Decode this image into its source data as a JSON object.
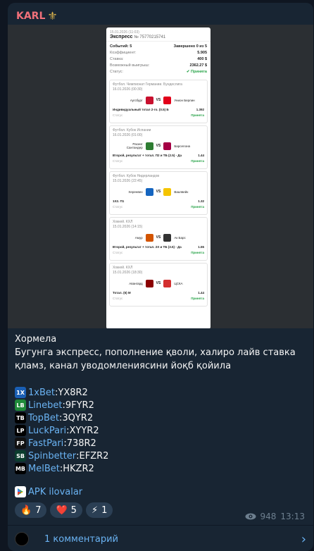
{
  "channel": {
    "name": "KARL",
    "emblem": "⚜"
  },
  "coupon": {
    "date": "15.01.2026 (11:03)",
    "type": "Экспресс",
    "number": "№ 75770215741",
    "events_label": "Событий: 5",
    "finished_label": "Завершено 0 из 5",
    "coef_label": "Коэффициент:",
    "coef_value": "5.905",
    "stake_label": "Ставка:",
    "stake_value": "400 $",
    "win_label": "Возможный выигрыш:",
    "win_value": "2362.27 $",
    "status_label": "Статус:",
    "status_value": "Принята",
    "matches": [
      {
        "league": "Футбол. Чемпионат Германии. Бундеслига",
        "date": "16.01.2026 (00:30)",
        "home": "Аугсбург",
        "away": "Унион Берлин",
        "vs": "VS",
        "bet": "Индивидуальный тотал 2-го. (0.5) Б",
        "odd": "1.392",
        "status_label": "Статус",
        "status": "Принята",
        "home_color": "#c8102e",
        "away_color": "#e2001a"
      },
      {
        "league": "Футбол. Кубок Испании",
        "date": "16.01.2026 (01:00)",
        "home": "Расинг Сантандер",
        "away": "Барселона",
        "vs": "VS",
        "bet": "Второй, результат + тотал. П2 и ТБ (2.5) - Да",
        "odd": "1.44",
        "status_label": "Статус",
        "status": "Принята",
        "home_color": "#2e7d32",
        "away_color": "#a50044"
      },
      {
        "league": "Футбол. Кубок Нидерландов",
        "date": "15.01.2026 (22:45)",
        "home": "Херенвен",
        "away": "Ваалвейк",
        "vs": "VS",
        "bet": "1Х2. П1",
        "odd": "1.32",
        "status_label": "Статус",
        "status": "Принята",
        "home_color": "#1565c0",
        "away_color": "#f5c400"
      },
      {
        "league": "Хоккей. КХЛ",
        "date": "15.01.2026 (14:15)",
        "home": "Амур",
        "away": "Ак Барс",
        "vs": "VS",
        "bet": "Второй, результат + тотал. 2Х и ТБ (3.5) - Да",
        "odd": "1.55",
        "status_label": "Статус",
        "status": "Принята",
        "home_color": "#d35400",
        "away_color": "#333333"
      },
      {
        "league": "Хоккей. КХЛ",
        "date": "15.01.2026 (18:30)",
        "home": "Авангард",
        "away": "ЦСКА",
        "vs": "VS",
        "bet": "Тотал. (6) М",
        "odd": "1.44",
        "status_label": "Статус",
        "status": "Принята",
        "home_color": "#8b0000",
        "away_color": "#d32f2f"
      }
    ]
  },
  "message": {
    "title": "Хормела",
    "body": "Бугунга экспресс, пополнение қволи, халиро лайв ставка қламз, канал уводомлениясини йоқб қойила"
  },
  "bookmakers": [
    {
      "name": "1xBet",
      "code": "YX8R2",
      "icon_text": "1X",
      "color": "#1a5fb4"
    },
    {
      "name": "Linebet",
      "code": "9FYR2",
      "icon_text": "LB",
      "color": "#1f8a3a"
    },
    {
      "name": "TopBet",
      "code": "3QYR2",
      "icon_text": "TB",
      "color": "#000000"
    },
    {
      "name": "LuckPari",
      "code": "XYYR2",
      "icon_text": "LP",
      "color": "#000000"
    },
    {
      "name": "FastPari",
      "code": "738R2",
      "icon_text": "FP",
      "color": "#111111"
    },
    {
      "name": "Spinbetter",
      "code": "EFZR2",
      "icon_text": "SB",
      "color": "#0b3d2e"
    },
    {
      "name": "MelBet",
      "code": "HKZR2",
      "icon_text": "MB",
      "color": "#000000"
    }
  ],
  "apk": {
    "label": "APK ilovalar"
  },
  "reactions": [
    {
      "emoji": "🔥",
      "count": "7"
    },
    {
      "emoji": "❤️",
      "count": "5"
    },
    {
      "emoji": "⚡",
      "count": "1"
    }
  ],
  "meta": {
    "views": "948",
    "time": "13:13"
  },
  "comments": {
    "label": "1 комментарий"
  }
}
